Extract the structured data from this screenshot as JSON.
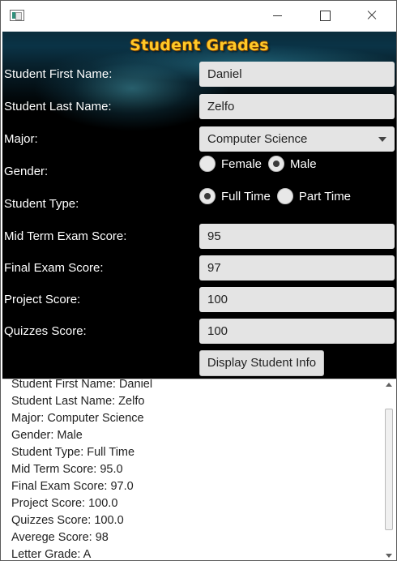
{
  "window": {
    "title_bar_icon": "app-window-icon",
    "controls": [
      "minimize-icon",
      "maximize-icon",
      "close-icon"
    ]
  },
  "banner": {
    "title": "Student Grades"
  },
  "form": {
    "first_name": {
      "label": "Student First Name:",
      "value": "Daniel"
    },
    "last_name": {
      "label": "Student Last Name:",
      "value": "Zelfo"
    },
    "major": {
      "label": "Major:",
      "value": "Computer Science"
    },
    "gender": {
      "label": "Gender:",
      "options": [
        "Female",
        "Male"
      ],
      "selected": "Male"
    },
    "student_type": {
      "label": "Student Type:",
      "options": [
        "Full Time",
        "Part Time"
      ],
      "selected": "Full Time"
    },
    "midterm": {
      "label": "Mid Term Exam Score:",
      "value": "95"
    },
    "final": {
      "label": "Final Exam Score:",
      "value": "97"
    },
    "project": {
      "label": "Project Score:",
      "value": "100"
    },
    "quizzes": {
      "label": "Quizzes Score:",
      "value": "100"
    },
    "display_button": "Display Student Info"
  },
  "output": {
    "lines": [
      "Student First Name: Daniel",
      "Student Last Name: Zelfo",
      "Major: Computer Science",
      "Gender: Male",
      "Student Type: Full Time",
      "Mid Term Score: 95.0",
      "Final Exam Score: 97.0",
      "Project Score: 100.0",
      "Quizzes Score: 100.0",
      "Averege Score: 98",
      "Letter Grade: A"
    ]
  },
  "colors": {
    "banner_title": "#ffc928",
    "form_background": "#000000",
    "field_background": "#e4e4e4",
    "label_text": "#ffffff"
  }
}
